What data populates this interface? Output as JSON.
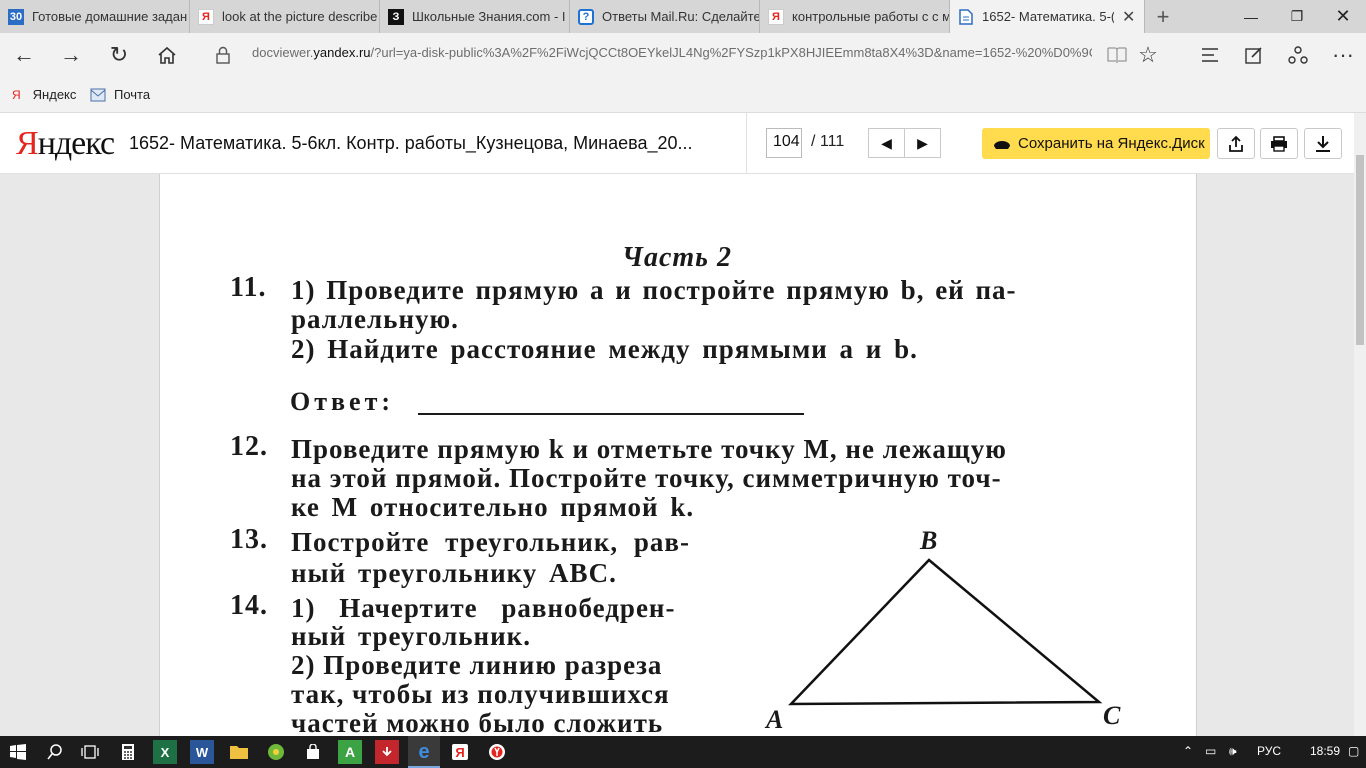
{
  "tabs": [
    {
      "title": "Готовые домашние задан",
      "icon": "30",
      "active": false
    },
    {
      "title": "look at the picture describe",
      "icon": "Я",
      "active": false
    },
    {
      "title": "Школьные Знания.com - I",
      "icon": "З",
      "active": false
    },
    {
      "title": "Ответы Mail.Ru: Сделайте",
      "icon": "?",
      "active": false
    },
    {
      "title": "контрольные работы с с м",
      "icon": "Я",
      "active": false
    },
    {
      "title": "1652- Математика. 5-(",
      "icon": "doc",
      "active": true
    }
  ],
  "address": {
    "prefix": "docviewer.",
    "domain": "yandex.ru",
    "rest": "/?url=ya-disk-public%3A%2F%2FiWcjQCCt8OEYkelJL4Ng%2FYSzp1kPX8HJIEEmm8ta8X4%3D&name=1652-%20%D0%9C%D0%"
  },
  "favorites": [
    {
      "label": "Яндекс"
    },
    {
      "label": "Почта"
    }
  ],
  "viewer": {
    "logo_first": "Я",
    "logo_rest": "ндекс",
    "doc_title": "1652- Математика. 5-6кл. Контр. работы_Кузнецова, Минаева_20...",
    "page_current": "104",
    "page_total": "/ 111",
    "save_label": "Сохранить на Яндекс.Диск"
  },
  "document": {
    "part_title": "Часть 2",
    "t11_num": "11.",
    "t11_l1": "1) Проведите прямую a и постройте прямую b, ей па-",
    "t11_l2": "раллельную.",
    "t11_l3": "2) Найдите расстояние между прямыми a и b.",
    "answer_label": "Ответ:",
    "t12_num": "12.",
    "t12_l1": "Проведите прямую k и отметьте точку M, не лежащую",
    "t12_l2": "на этой прямой. Постройте точку, симметричную точ-",
    "t12_l3": "ке M относительно прямой k.",
    "t13_num": "13.",
    "t13_l1": "Постройте треугольник, рав-",
    "t13_l2": "ный треугольнику ABC.",
    "t14_num": "14.",
    "t14_l1": "1) Начертите равнобедрен-",
    "t14_l2": "ный треугольник.",
    "t14_l3": "2) Проведите линию разреза",
    "t14_l4": "так, чтобы из получившихся",
    "t14_l5": "частей можно было сложить",
    "vertex_a": "A",
    "vertex_b": "B",
    "vertex_c": "C"
  },
  "taskbar": {
    "lang": "РУС",
    "time": "18:59"
  },
  "colors": {
    "yandex_red": "#e52620",
    "save_yellow": "#ffdb4d",
    "taskbar": "#1c1c1c"
  }
}
